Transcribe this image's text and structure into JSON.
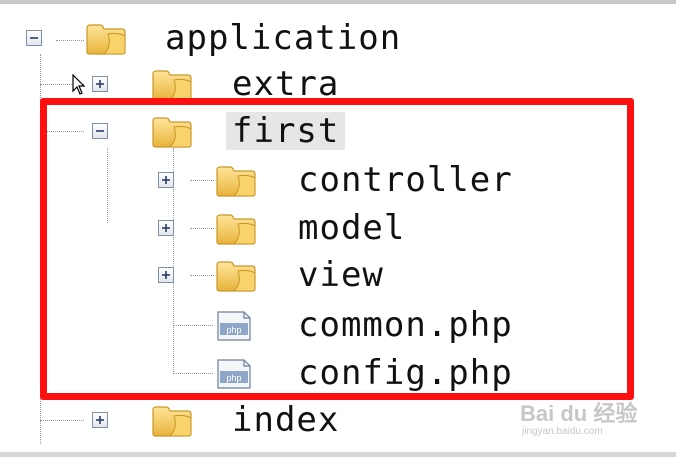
{
  "tree": {
    "root": {
      "label": "application",
      "icon": "folder-icon",
      "state": "expanded"
    },
    "children": [
      {
        "label": "extra",
        "icon": "folder-icon",
        "state": "collapsed"
      },
      {
        "label": "first",
        "icon": "folder-icon",
        "state": "expanded",
        "selected": true,
        "children": [
          {
            "label": "controller",
            "icon": "folder-icon",
            "state": "collapsed"
          },
          {
            "label": "model",
            "icon": "folder-icon",
            "state": "collapsed"
          },
          {
            "label": "view",
            "icon": "folder-icon",
            "state": "collapsed"
          },
          {
            "label": "common.php",
            "icon": "php-file-icon"
          },
          {
            "label": "config.php",
            "icon": "php-file-icon"
          }
        ]
      },
      {
        "label": "index",
        "icon": "folder-icon",
        "state": "collapsed"
      }
    ]
  },
  "file_icon_text": "php",
  "watermark": {
    "brand": "Bai du 经验",
    "url": "jingyan.baidu.com"
  },
  "colors": {
    "highlight": "#ff1010",
    "folder": "#f2c44d",
    "selection": "#e6e6e6"
  }
}
